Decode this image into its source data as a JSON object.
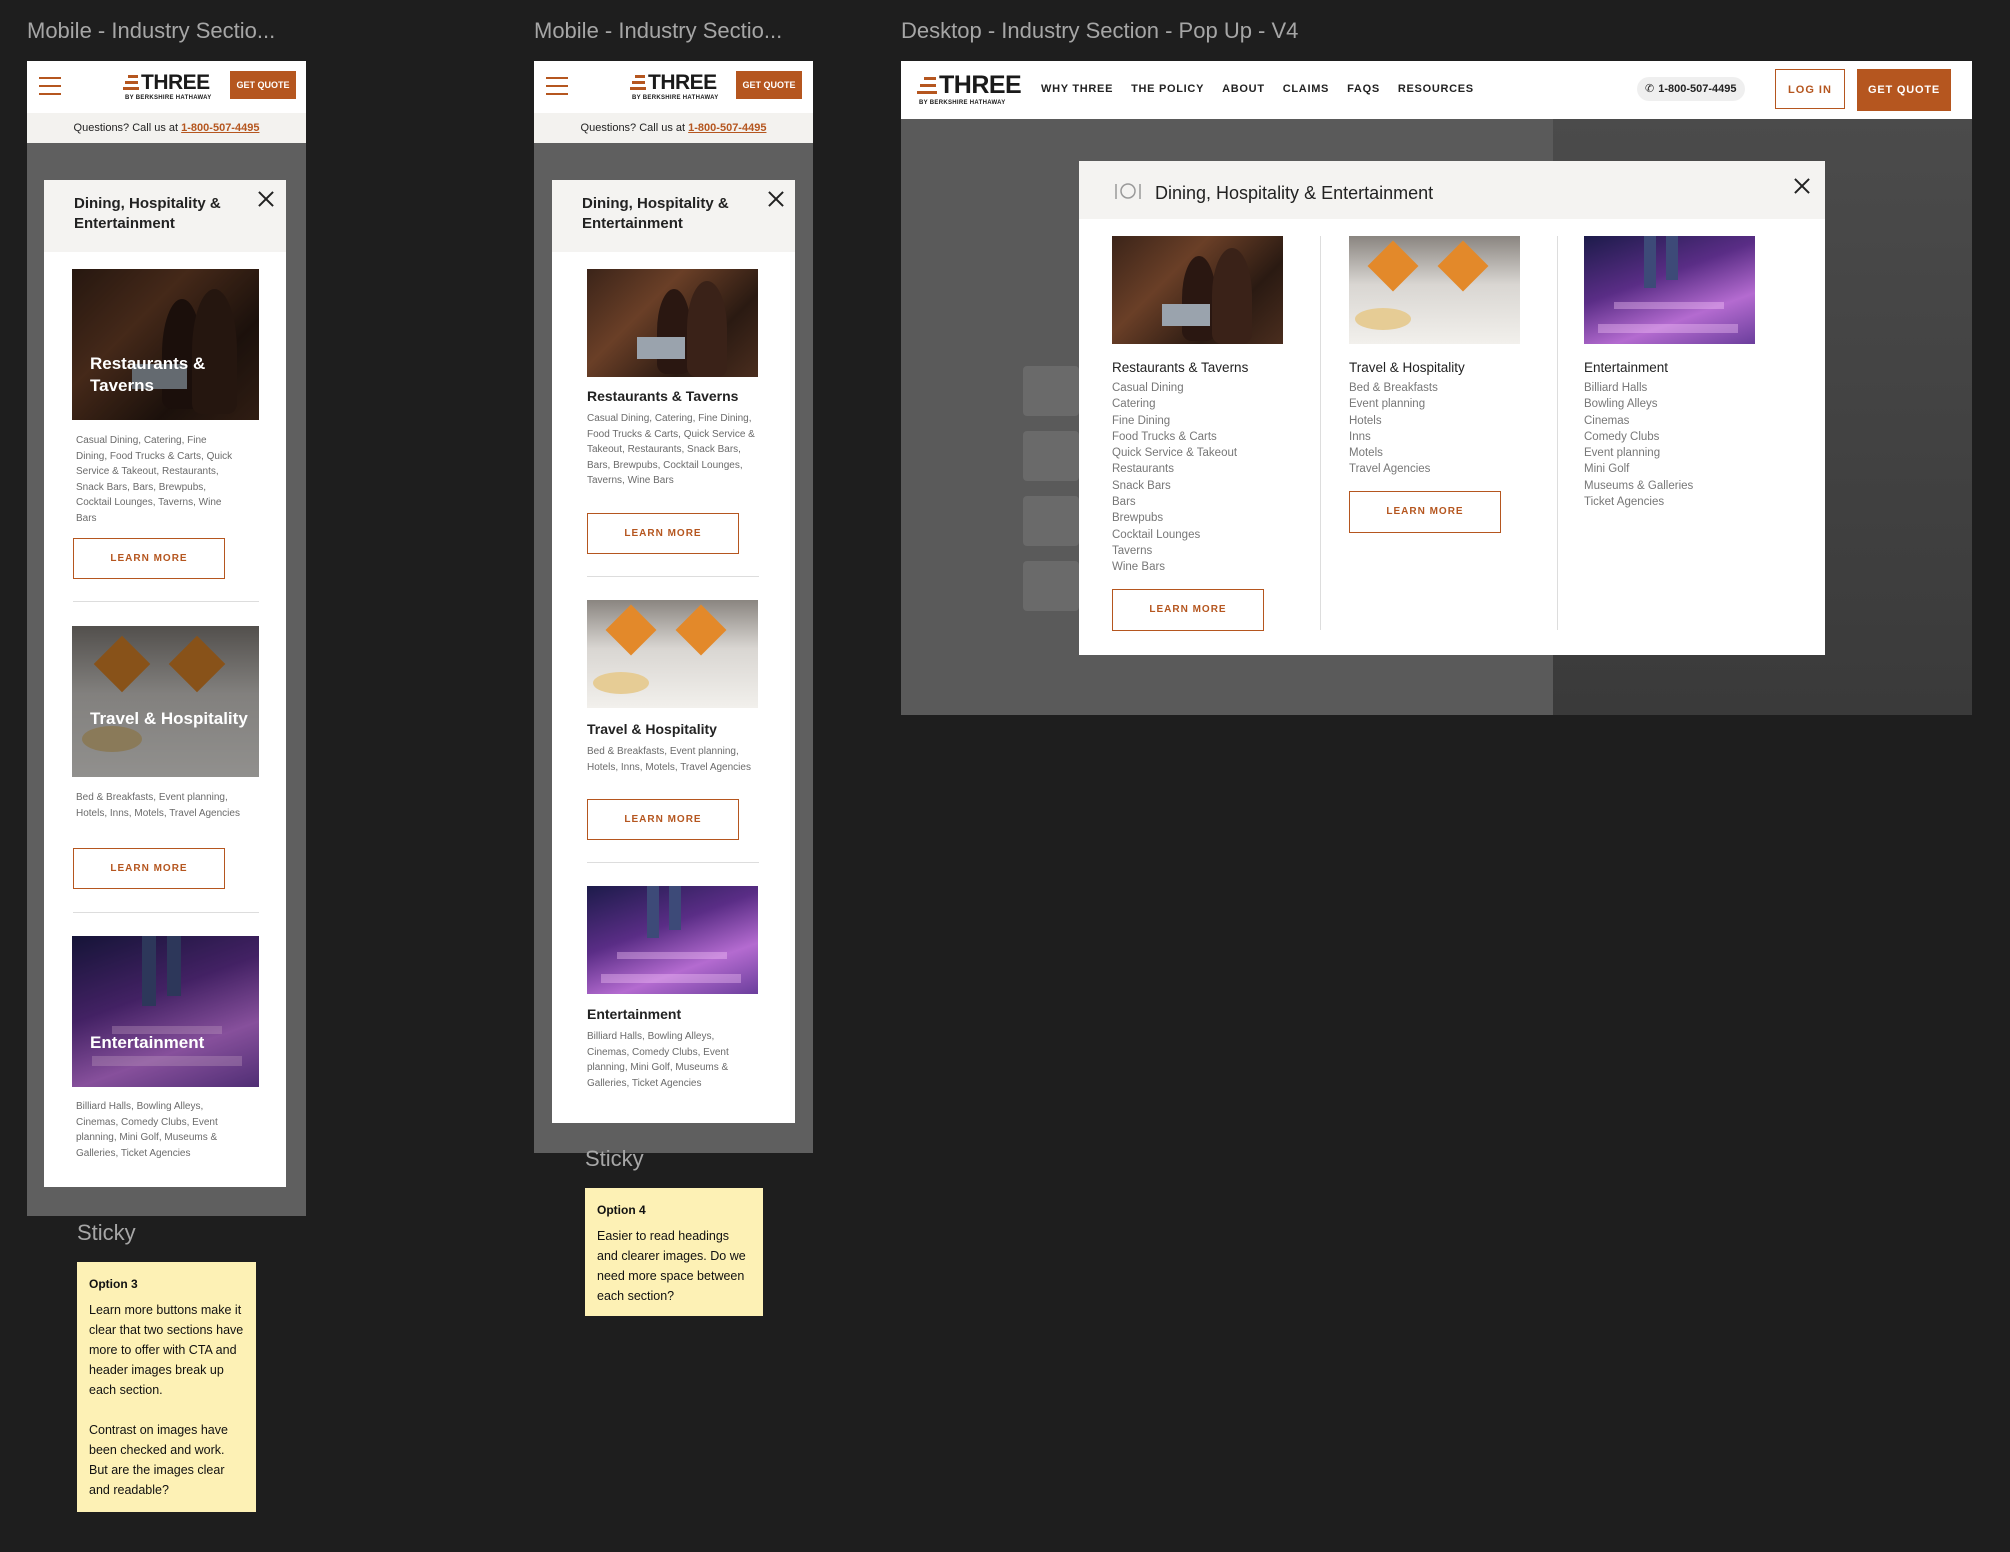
{
  "frames": {
    "mobile_a_label": "Mobile - Industry Sectio...",
    "mobile_b_label": "Mobile - Industry Sectio...",
    "desktop_label": "Desktop - Industry Section - Pop Up - V4"
  },
  "brand": {
    "logo_word": "THREE",
    "logo_sub": "BY BERKSHIRE HATHAWAY",
    "accent": "#b5561f"
  },
  "mobile_header": {
    "get_quote": "GET QUOTE",
    "questions_text": "Questions? Call us at",
    "phone": "1-800-507-4495"
  },
  "modal": {
    "title": "Dining, Hospitality & Entertainment"
  },
  "sections": [
    {
      "title": "Restaurants & Taverns",
      "desc": "Casual Dining, Catering, Fine Dining, Food Trucks & Carts, Quick Service & Takeout, Restaurants, Snack Bars, Bars, Brewpubs, Cocktail Lounges, Taverns, Wine Bars",
      "button": "LEARN MORE",
      "list": [
        "Casual Dining",
        "Catering",
        "Fine Dining",
        "Food Trucks & Carts",
        "Quick Service & Takeout",
        "Restaurants",
        "Snack Bars",
        "Bars",
        "Brewpubs",
        "Cocktail Lounges",
        "Taverns",
        "Wine Bars"
      ]
    },
    {
      "title": "Travel & Hospitality",
      "desc": "Bed & Breakfasts, Event planning, Hotels, Inns, Motels, Travel Agencies",
      "button": "LEARN MORE",
      "list": [
        "Bed & Breakfasts",
        "Event planning",
        "Hotels",
        "Inns",
        "Motels",
        "Travel Agencies"
      ]
    },
    {
      "title": "Entertainment",
      "desc": "Billiard Halls, Bowling Alleys, Cinemas, Comedy Clubs, Event planning, Mini Golf, Museums & Galleries, Ticket Agencies",
      "list": [
        "Billiard Halls",
        "Bowling Alleys",
        "Cinemas",
        "Comedy Clubs",
        "Event planning",
        "Mini Golf",
        "Museums & Galleries",
        "Ticket Agencies"
      ]
    }
  ],
  "stickies": {
    "label": "Sticky",
    "option3_title": "Option 3",
    "option3_p1": "Learn more buttons make it clear that two sections have more to offer with CTA and header images break up each section.",
    "option3_p2": "Contrast on images have been checked and work. But are the images clear and readable?",
    "option4_title": "Option 4",
    "option4_text": "Easier to read headings and clearer images. Do we need more space between each section?"
  },
  "desktop": {
    "nav": [
      "WHY THREE",
      "THE POLICY",
      "ABOUT",
      "CLAIMS",
      "FAQS",
      "RESOURCES"
    ],
    "phone": "1-800-507-4495",
    "login": "LOG IN",
    "get_quote": "GET QUOTE"
  },
  "icons": [
    "hamburger-icon",
    "close-icon",
    "phone-icon",
    "dining-icon"
  ]
}
